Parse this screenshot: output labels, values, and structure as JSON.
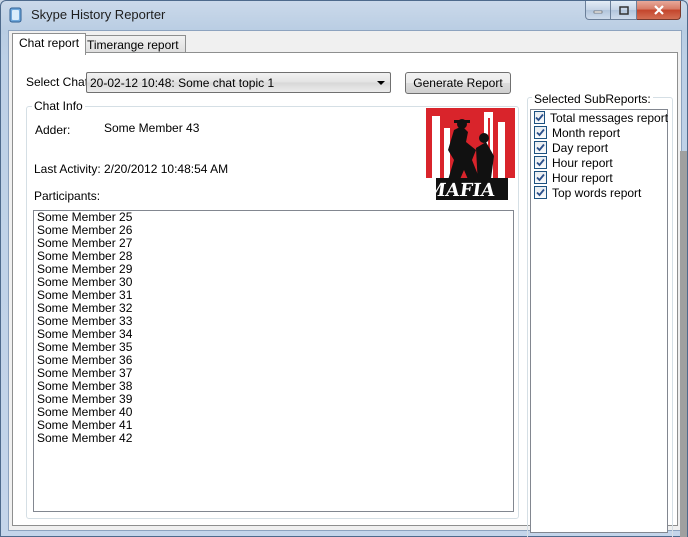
{
  "window": {
    "title": "Skype History Reporter"
  },
  "tabs": [
    {
      "label": "Chat report",
      "active": true
    },
    {
      "label": "Timerange report",
      "active": false
    }
  ],
  "select_chat": {
    "label": "Select Chat",
    "value": "20-02-12 10:48: Some chat topic 1"
  },
  "generate_button": "Generate Report",
  "chat_info": {
    "group_label": "Chat Info",
    "adder_label": "Adder:",
    "adder_value": "Some Member 43",
    "last_activity_label": "Last Activity:",
    "last_activity_value": "2/20/2012 10:48:54 AM",
    "participants_label": "Participants:",
    "participants": [
      "Some Member 25",
      "Some Member 26",
      "Some Member 27",
      "Some Member 28",
      "Some Member 29",
      "Some Member 30",
      "Some Member 31",
      "Some Member 32",
      "Some Member 33",
      "Some Member 34",
      "Some Member 35",
      "Some Member 36",
      "Some Member 37",
      "Some Member 38",
      "Some Member 39",
      "Some Member 40",
      "Some Member 41",
      "Some Member 42"
    ],
    "logo_text": "MAFIA"
  },
  "subreports": {
    "group_label": "Selected SubReports:",
    "items": [
      {
        "label": "Total messages report",
        "checked": true
      },
      {
        "label": "Month report",
        "checked": true
      },
      {
        "label": "Day report",
        "checked": true
      },
      {
        "label": "Hour report",
        "checked": true
      },
      {
        "label": "Hour report",
        "checked": true
      },
      {
        "label": "Top words report",
        "checked": true
      }
    ]
  }
}
